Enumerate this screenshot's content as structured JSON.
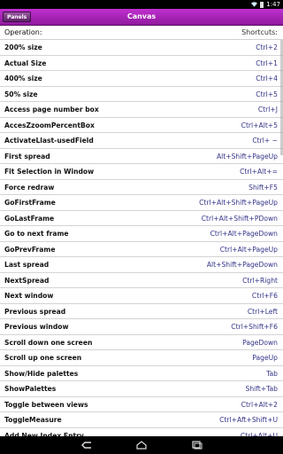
{
  "status_bar": {
    "time": "1:47",
    "wifi_icon": "wifi-icon",
    "battery_icon": "battery-icon"
  },
  "title_bar": {
    "panels_label": "Panels",
    "title": "Canvas"
  },
  "header": {
    "operation": "Operation:",
    "shortcuts": "Shortcuts:"
  },
  "rows": [
    {
      "label": "200% size",
      "shortcut": "Ctrl+2"
    },
    {
      "label": "Actual Size",
      "shortcut": "Ctrl+1"
    },
    {
      "label": "400% size",
      "shortcut": "Ctrl+4"
    },
    {
      "label": "50% size",
      "shortcut": "Ctrl+5"
    },
    {
      "label": "Access page number box",
      "shortcut": "Ctrl+J"
    },
    {
      "label": "AccesZzoomPercentBox",
      "shortcut": "Ctrl+Alt+5"
    },
    {
      "label": "ActivateLlast-usedField",
      "shortcut": "Ctrl+ ~"
    },
    {
      "label": "First spread",
      "shortcut": "Alt+Shift+PageUp"
    },
    {
      "label": "Fit Selection in Window",
      "shortcut": "Ctrl+Alt+="
    },
    {
      "label": "Force redraw",
      "shortcut": "Shift+F5"
    },
    {
      "label": "GoFirstFrame",
      "shortcut": "Ctrl+Alt+Shift+PageUp"
    },
    {
      "label": "GoLastFrame",
      "shortcut": "Ctrl+Alt+Shift+PDown"
    },
    {
      "label": "Go to next frame",
      "shortcut": "Ctrl+Alt+PageDown"
    },
    {
      "label": "GoPrevFrame",
      "shortcut": "Ctrl+Alt+PageUp"
    },
    {
      "label": "Last spread",
      "shortcut": "Alt+Shift+PageDown"
    },
    {
      "label": "NextSpread",
      "shortcut": "Ctrl+Right"
    },
    {
      "label": "Next window",
      "shortcut": "Ctrl+F6"
    },
    {
      "label": "Previous spread",
      "shortcut": "Ctrl+Left"
    },
    {
      "label": "Previous window",
      "shortcut": "Ctrl+Shift+F6"
    },
    {
      "label": "Scroll down one screen",
      "shortcut": "PageDown"
    },
    {
      "label": "Scroll up one screen",
      "shortcut": "PageUp"
    },
    {
      "label": "Show/Hide palettes",
      "shortcut": "Tab"
    },
    {
      "label": "ShowPalettes",
      "shortcut": "Shift+Tab"
    },
    {
      "label": "Toggle between views",
      "shortcut": "Ctrl+Alt+2"
    },
    {
      "label": "ToggleMeasure",
      "shortcut": "Ctrl+Aft+Shift+U"
    },
    {
      "label": "Add New Index Entry",
      "shortcut": "Ctrl+Alt+U"
    }
  ],
  "nav_bar": {
    "back_icon": "back-icon",
    "home_icon": "home-icon",
    "recents_icon": "recents-icon"
  }
}
